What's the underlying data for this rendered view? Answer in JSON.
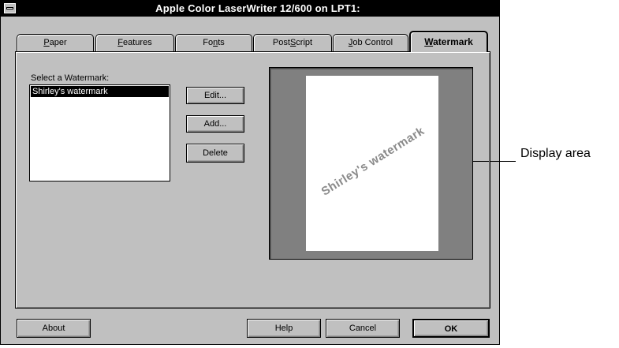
{
  "window": {
    "title": "Apple Color LaserWriter 12/600 on LPT1:"
  },
  "tabs": [
    {
      "label": "Paper",
      "accel": "P"
    },
    {
      "label": "Features",
      "accel": "F"
    },
    {
      "label": "Fonts",
      "accel": "n"
    },
    {
      "label": "PostScript",
      "accel": "S"
    },
    {
      "label": "Job Control",
      "accel": "J"
    },
    {
      "label": "Watermark",
      "accel": "W",
      "active": true
    }
  ],
  "watermark_panel": {
    "list_label": "Select a Watermark:",
    "items": [
      "Shirley's watermark"
    ],
    "selected_item": "Shirley's watermark",
    "buttons": {
      "edit": "Edit...",
      "add": "Add...",
      "delete": "Delete"
    },
    "preview_text": "Shirley's watermark"
  },
  "footer": {
    "about": "About",
    "help": "Help",
    "cancel": "Cancel",
    "ok": "OK"
  },
  "callout": {
    "label": "Display area"
  },
  "colors": {
    "titlebar": "#000000",
    "dialog": "#c0c0c0",
    "preview_bg": "#808080",
    "watermark_text": "#8a8a8a"
  }
}
